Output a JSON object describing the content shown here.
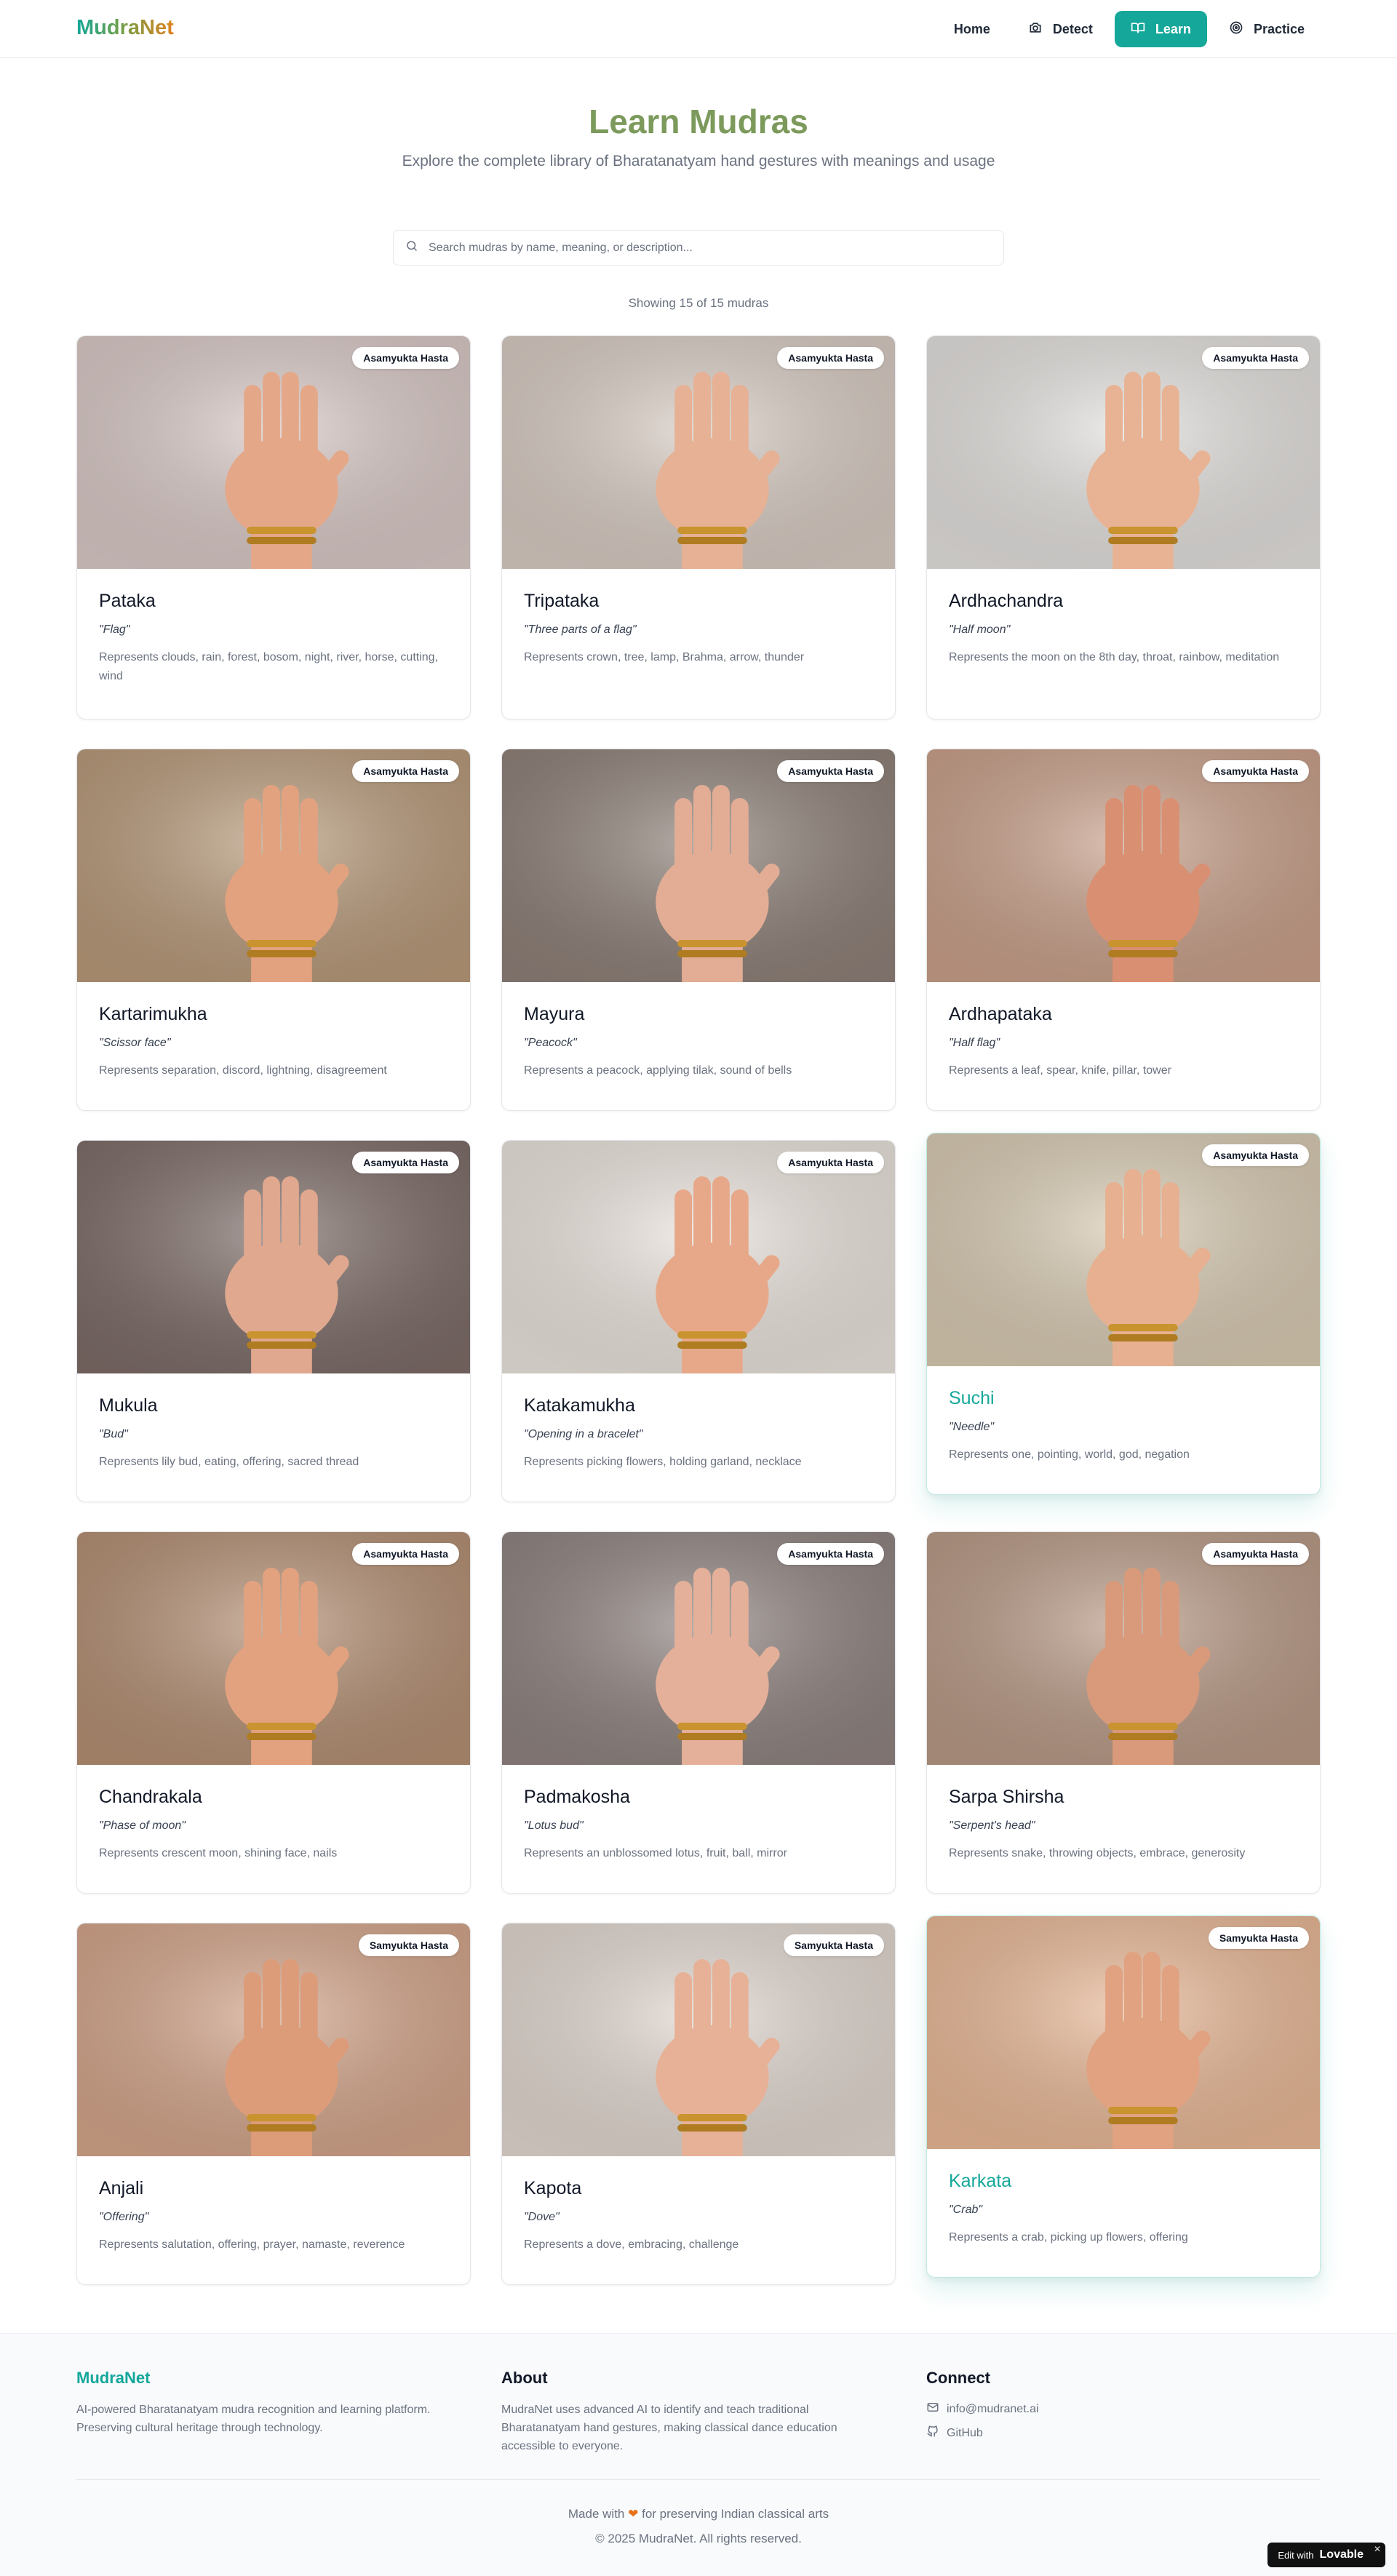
{
  "nav": {
    "logo": "MudraNet",
    "links": [
      {
        "label": "Home",
        "icon": "home",
        "active": false
      },
      {
        "label": "Detect",
        "icon": "camera-icon",
        "active": false
      },
      {
        "label": "Learn",
        "icon": "book-open-icon",
        "active": true
      },
      {
        "label": "Practice",
        "icon": "target-icon",
        "active": false
      }
    ]
  },
  "hero": {
    "title": "Learn Mudras",
    "subtitle": "Explore the complete library of Bharatanatyam hand gestures with meanings and usage"
  },
  "search": {
    "placeholder": "Search mudras by name, meaning, or description...",
    "value": ""
  },
  "results": {
    "count_text": "Showing 15 of 15 mudras"
  },
  "mudras": [
    {
      "name": "Pataka",
      "meaning": "\"Flag\"",
      "description": "Represents clouds, rain, forest, bosom, night, river, horse, cutting, wind",
      "category": "Asamyukta Hasta",
      "bg": "#d9c9c6",
      "skin": "#e4a889"
    },
    {
      "name": "Tripataka",
      "meaning": "\"Three parts of a flag\"",
      "description": "Represents crown, tree, lamp, Brahma, arrow, thunder",
      "category": "Asamyukta Hasta",
      "bg": "#d8ccc3",
      "skin": "#e6b194"
    },
    {
      "name": "Ardhachandra",
      "meaning": "\"Half moon\"",
      "description": "Represents the moon on the 8th day, throat, rainbow, meditation",
      "category": "Asamyukta Hasta",
      "bg": "#e4e1de",
      "skin": "#e8b394"
    },
    {
      "name": "Kartarimukha",
      "meaning": "\"Scissor face\"",
      "description": "Represents separation, discord, lightning, disagreement",
      "category": "Asamyukta Hasta",
      "bg": "#b89a7a",
      "skin": "#e3a27f"
    },
    {
      "name": "Mayura",
      "meaning": "\"Peacock\"",
      "description": "Represents a peacock, applying tilak, sound of bells",
      "category": "Asamyukta Hasta",
      "bg": "#8e8078",
      "skin": "#e3ad95"
    },
    {
      "name": "Ardhapataka",
      "meaning": "\"Half flag\"",
      "description": "Represents a leaf, spear, knife, pillar, tower",
      "category": "Asamyukta Hasta",
      "bg": "#c9a08a",
      "skin": "#d98f72"
    },
    {
      "name": "Mukula",
      "meaning": "\"Bud\"",
      "description": "Represents lily bud, eating, offering, sacred thread",
      "category": "Asamyukta Hasta",
      "bg": "#7d6c68",
      "skin": "#e0a88e"
    },
    {
      "name": "Katakamukha",
      "meaning": "\"Opening in a bracelet\"",
      "description": "Represents picking flowers, holding garland, necklace",
      "category": "Asamyukta Hasta",
      "bg": "#ebe4dd",
      "skin": "#e7a88a"
    },
    {
      "name": "Suchi",
      "meaning": "\"Needle\"",
      "description": "Represents one, pointing, world, god, negation",
      "category": "Asamyukta Hasta",
      "bg": "#d9cbb3",
      "skin": "#e6b091"
    },
    {
      "name": "Chandrakala",
      "meaning": "\"Phase of moon\"",
      "description": "Represents crescent moon, shining face, nails",
      "category": "Asamyukta Hasta",
      "bg": "#b48f73",
      "skin": "#e2a27f"
    },
    {
      "name": "Padmakosha",
      "meaning": "\"Lotus bud\"",
      "description": "Represents an unblossomed lotus, fruit, ball, mirror",
      "category": "Asamyukta Hasta",
      "bg": "#8f8380",
      "skin": "#e4b09a"
    },
    {
      "name": "Sarpa Shirsha",
      "meaning": "\"Serpent's head\"",
      "description": "Represents snake, throwing objects, embrace, generosity",
      "category": "Asamyukta Hasta",
      "bg": "#b99a86",
      "skin": "#d99a7b"
    },
    {
      "name": "Anjali",
      "meaning": "\"Offering\"",
      "description": "Represents salutation, offering, prayer, namaste, reverence",
      "category": "Samyukta Hasta",
      "bg": "#d4a58a",
      "skin": "#dc9c7a"
    },
    {
      "name": "Kapota",
      "meaning": "\"Dove\"",
      "description": "Represents a dove, embracing, challenge",
      "category": "Samyukta Hasta",
      "bg": "#e2d8d0",
      "skin": "#e7b197"
    },
    {
      "name": "Karkata",
      "meaning": "\"Crab\"",
      "description": "Represents a crab, picking up flowers, offering",
      "category": "Samyukta Hasta",
      "bg": "#e9b896",
      "skin": "#e1a281"
    }
  ],
  "footer": {
    "brand": "MudraNet",
    "brand_text": "AI-powered Bharatanatyam mudra recognition and learning platform. Preserving cultural heritage through technology.",
    "about_title": "About",
    "about_text": "MudraNet uses advanced AI to identify and teach traditional Bharatanatyam hand gestures, making classical dance education accessible to everyone.",
    "connect_title": "Connect",
    "email": "info@mudranet.ai",
    "github": "GitHub",
    "made_prefix": "Made with",
    "made_suffix": "for preserving Indian classical arts",
    "copyright": "© 2025 MudraNet. All rights reserved."
  },
  "badge": {
    "prefix": "Edit with",
    "brand": "Lovable"
  }
}
